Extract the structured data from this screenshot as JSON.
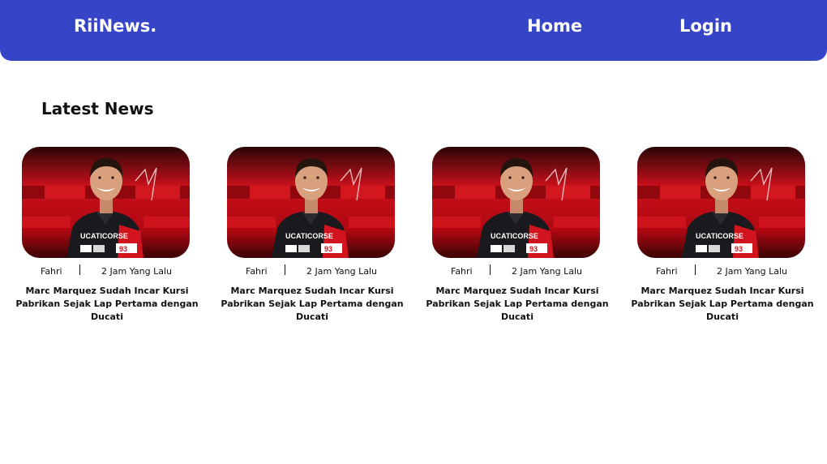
{
  "navbar": {
    "brand": "RiiNews.",
    "links": [
      {
        "label": "Home"
      },
      {
        "label": "Login"
      }
    ],
    "color": "#3645c7"
  },
  "section": {
    "title": "Latest News"
  },
  "cards": [
    {
      "author": "Fahri",
      "time": "2 Jam Yang Lalu",
      "headline": "Marc Marquez Sudah Incar Kursi Pabrikan Sejak Lap Pertama dengan Ducati",
      "image": "rider-portrait-image"
    },
    {
      "author": "Fahri",
      "time": "2 Jam Yang Lalu",
      "headline": "Marc Marquez Sudah Incar Kursi Pabrikan Sejak Lap Pertama dengan Ducati",
      "image": "rider-portrait-image"
    },
    {
      "author": "Fahri",
      "time": "2 Jam Yang Lalu",
      "headline": "Marc Marquez Sudah Incar Kursi Pabrikan Sejak Lap Pertama dengan Ducati",
      "image": "rider-portrait-image"
    },
    {
      "author": "Fahri",
      "time": "2 Jam Yang Lalu",
      "headline": "Marc Marquez Sudah Incar Kursi Pabrikan Sejak Lap Pertama dengan Ducati",
      "image": "rider-portrait-image"
    }
  ],
  "image_text": {
    "shirt": "UCATICORSE",
    "number": "93"
  }
}
